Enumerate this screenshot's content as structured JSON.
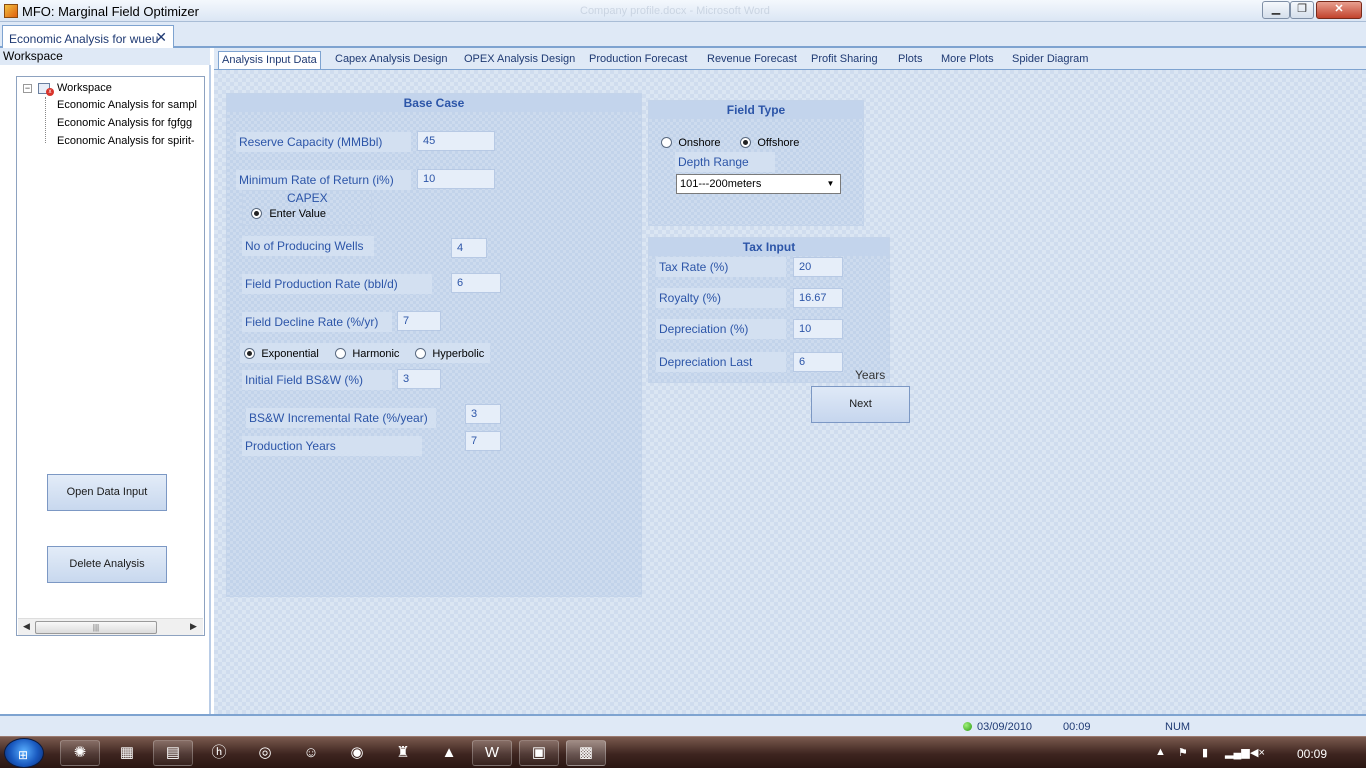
{
  "window": {
    "title": "MFO: Marginal Field Optimizer",
    "background_text": "Company profile.docx - Microsoft Word"
  },
  "doc_tab": {
    "label": "Economic Analysis for wueu",
    "close": "✕"
  },
  "workspace": {
    "header": "Workspace",
    "tree": {
      "root": "Workspace",
      "items": [
        "Economic Analysis for sampl",
        "Economic Analysis for fgfgg",
        "Economic Analysis for spirit-"
      ]
    },
    "open_button": "Open Data Input",
    "delete_button": "Delete Analysis"
  },
  "tabs": [
    "Analysis Input Data",
    "Capex Analysis Design",
    "OPEX Analysis Design",
    "Production Forecast",
    "Revenue Forecast",
    "Profit Sharing",
    "Plots",
    "More Plots",
    "Spider Diagram"
  ],
  "base_case": {
    "title": "Base Case",
    "reserve_capacity": {
      "label": "Reserve Capacity (MMBbl)",
      "value": "45"
    },
    "min_rate_return": {
      "label": "Minimum Rate of Return (i%)",
      "value": "10"
    },
    "capex": {
      "title": "CAPEX",
      "option": "Enter Value"
    },
    "producing_wells": {
      "label": "No of Producing Wells",
      "value": "4"
    },
    "field_prod_rate": {
      "label": "Field Production Rate (bbl/d)",
      "value": "6"
    },
    "field_decline_rate": {
      "label": "Field Decline Rate (%/yr)",
      "value": "7"
    },
    "decline_types": {
      "exponential": "Exponential",
      "harmonic": "Harmonic",
      "hyperbolic": "Hyperbolic",
      "selected": "Exponential"
    },
    "initial_bsw": {
      "label": "Initial Field BS&W (%)",
      "value": "3"
    },
    "bsw_incremental": {
      "label": "BS&W Incremental Rate (%/year)",
      "value": "3"
    },
    "production_years": {
      "label": "Production Years",
      "value": "7"
    }
  },
  "field_type": {
    "title": "Field Type",
    "onshore": "Onshore",
    "offshore": "Offshore",
    "selected": "Offshore",
    "depth_label": "Depth Range",
    "depth_value": "101---200meters"
  },
  "tax_input": {
    "title": "Tax Input",
    "tax_rate": {
      "label": "Tax Rate (%)",
      "value": "20"
    },
    "royalty": {
      "label": "Royalty (%)",
      "value": "16.67"
    },
    "depreciation": {
      "label": "Depreciation (%)",
      "value": "10"
    },
    "depreciation_last": {
      "label": "Depreciation Last",
      "value": "6",
      "unit": "Years"
    }
  },
  "next_button": "Next",
  "statusbar": {
    "date": "03/09/2010",
    "time": "00:09",
    "num": "NUM"
  },
  "taskbar": {
    "clock": "00:09"
  },
  "colors": {
    "accent": "#2c55a8",
    "panel": "#dbe6f3",
    "titlebar": "#dbe6f4"
  }
}
